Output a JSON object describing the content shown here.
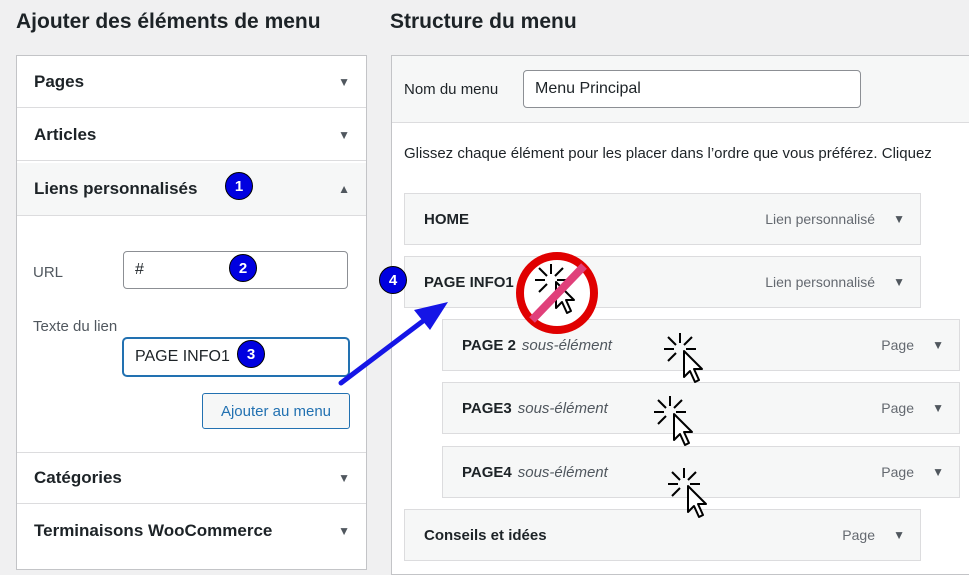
{
  "left": {
    "heading": "Ajouter des éléments de menu",
    "accordion": {
      "pages": "Pages",
      "articles": "Articles",
      "liens": "Liens personnalisés",
      "categories": "Catégories",
      "woo": "Terminaisons WooCommerce"
    },
    "url_label": "URL",
    "url_value": "#",
    "lien_label": "Texte du lien",
    "lien_value": "PAGE INFO1",
    "add_button": "Ajouter au menu"
  },
  "right": {
    "heading": "Structure du menu",
    "name_label": "Nom du menu",
    "name_value": "Menu Principal",
    "instructions": "Glissez chaque élément pour les placer dans l’ordre que vous préférez. Cliquez",
    "items": [
      {
        "title": "HOME",
        "sub": "",
        "type": "Lien personnalisé"
      },
      {
        "title": "PAGE INFO1",
        "sub": "",
        "type": "Lien personnalisé"
      },
      {
        "title": "PAGE 2",
        "sub": "sous-élément",
        "type": "Page"
      },
      {
        "title": "PAGE3",
        "sub": "sous-élément",
        "type": "Page"
      },
      {
        "title": "PAGE4",
        "sub": "sous-élément",
        "type": "Page"
      },
      {
        "title": "Conseils et idées",
        "sub": "",
        "type": "Page"
      }
    ]
  },
  "badges": {
    "b1": "1",
    "b2": "2",
    "b3": "3",
    "b4": "4"
  },
  "colors": {
    "accent": "#2271b1",
    "badge": "#0000e0",
    "no_sign": "#e00000",
    "no_bar": "#e0407a"
  }
}
